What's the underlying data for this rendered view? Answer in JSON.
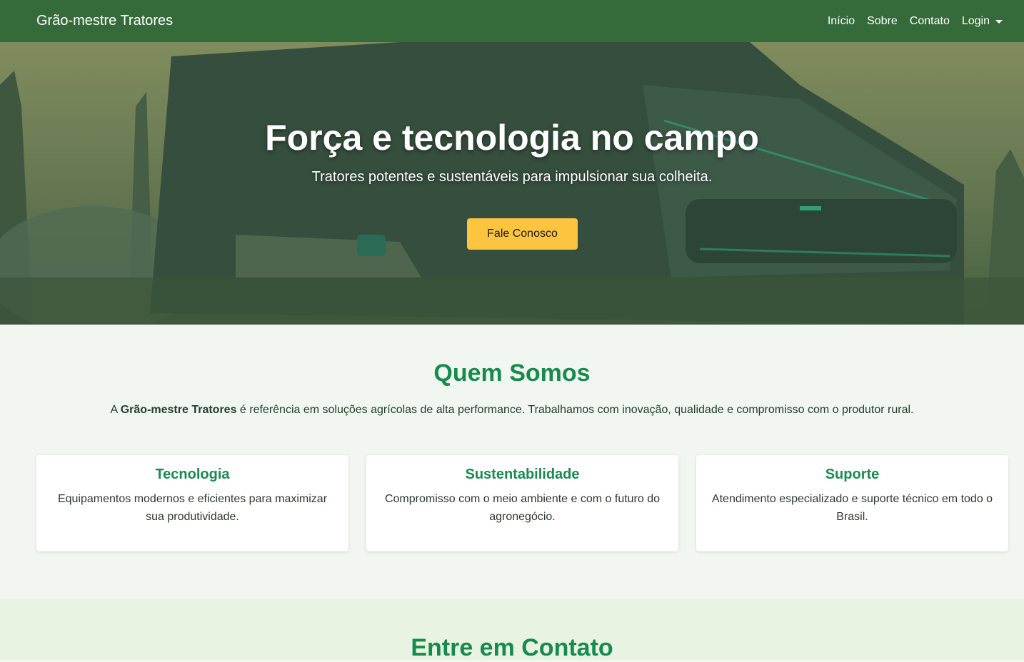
{
  "navbar": {
    "brand": "Grão-mestre Tratores",
    "links": [
      "Início",
      "Sobre",
      "Contato"
    ],
    "login_label": "Login"
  },
  "hero": {
    "title": "Força e tecnologia no campo",
    "subtitle": "Tratores potentes e sustentáveis para impulsionar sua colheita.",
    "cta_label": "Fale Conosco"
  },
  "about": {
    "title": "Quem Somos",
    "text_prefix": "A ",
    "text_brand": "Grão-mestre Tratores",
    "text_suffix": " é referência em soluções agrícolas de alta performance. Trabalhamos com inovação, qualidade e compromisso com o produtor rural.",
    "cards": [
      {
        "title": "Tecnologia",
        "text": "Equipamentos modernos e eficientes para maximizar sua produtividade."
      },
      {
        "title": "Sustentabilidade",
        "text": "Compromisso com o meio ambiente e com o futuro do agronegócio."
      },
      {
        "title": "Suporte",
        "text": "Atendimento especializado e suporte técnico em todo o Brasil."
      }
    ]
  },
  "contact": {
    "title": "Entre em Contato"
  },
  "colors": {
    "navbar": "#356a3b",
    "accent_green": "#178a4e",
    "cta_yellow": "#fcc43f",
    "about_bg": "#f1f6f0",
    "contact_bg": "#e9f3e1"
  }
}
